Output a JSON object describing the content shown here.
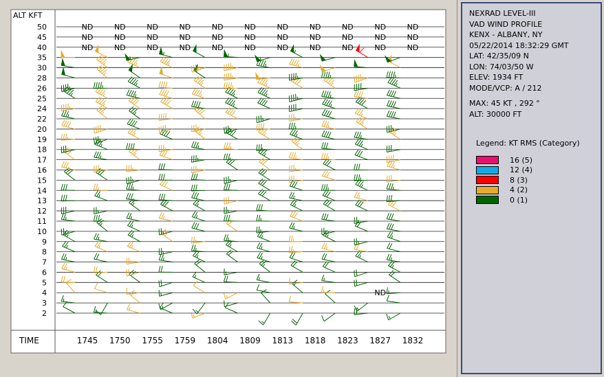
{
  "info": {
    "lines": [
      "NEXRAD LEVEL-III",
      "VAD WIND PROFILE",
      "KENX - ALBANY, NY",
      "05/22/2014 18:32:29 GMT",
      "LAT: 42/35/09 N",
      "LON: 74/03/50 W",
      "ELEV: 1934 FT",
      "MODE/VCP: A / 212"
    ],
    "max_line": "MAX: 45 KT , 292 °",
    "alt_line": "ALT: 30000 FT"
  },
  "legend": {
    "title": "Legend: KT RMS (Category)",
    "items": [
      {
        "label": "16  (5)",
        "color": "#e8106e"
      },
      {
        "label": "12  (4)",
        "color": "#11a9e8"
      },
      {
        "label": "8  (3)",
        "color": "#ff0000"
      },
      {
        "label": "4  (2)",
        "color": "#e8aa2c"
      },
      {
        "label": "0  (1)",
        "color": "#006400"
      }
    ]
  },
  "chart_data": {
    "type": "wind_profile",
    "ylabel": "ALT KFT",
    "xlabel": "TIME",
    "altitudes": [
      2,
      3,
      4,
      5,
      6,
      7,
      8,
      9,
      10,
      11,
      12,
      13,
      14,
      15,
      16,
      17,
      18,
      19,
      20,
      22,
      24,
      25,
      26,
      28,
      30,
      35,
      40,
      45,
      50
    ],
    "times": [
      "1745",
      "1750",
      "1755",
      "1759",
      "1804",
      "1809",
      "1813",
      "1818",
      "1823",
      "1827",
      "1832"
    ],
    "no_data_label": "ND",
    "no_data_altitudes": [
      40,
      45,
      50
    ],
    "extra_no_data": [
      {
        "time": "1827",
        "alt": 4
      }
    ]
  }
}
